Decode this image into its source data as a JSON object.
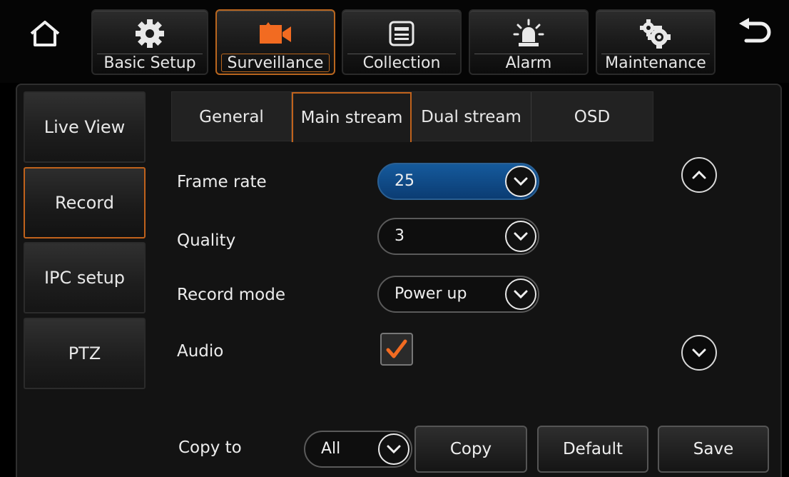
{
  "topnav": {
    "tabs": [
      {
        "label": "Basic Setup",
        "icon": "gear-icon"
      },
      {
        "label": "Surveillance",
        "icon": "camera-icon",
        "active": true
      },
      {
        "label": "Collection",
        "icon": "list-window-icon"
      },
      {
        "label": "Alarm",
        "icon": "alarm-light-icon"
      },
      {
        "label": "Maintenance",
        "icon": "maintenance-gear-icon"
      }
    ]
  },
  "sidebar": {
    "items": [
      {
        "label": "Live View"
      },
      {
        "label": "Record",
        "active": true
      },
      {
        "label": "IPC setup"
      },
      {
        "label": "PTZ"
      }
    ]
  },
  "subtabs": {
    "items": [
      {
        "label": "General"
      },
      {
        "label": "Main stream",
        "active": true
      },
      {
        "label": "Dual stream"
      },
      {
        "label": "OSD"
      }
    ]
  },
  "form": {
    "frame_rate": {
      "label": "Frame rate",
      "value": "25"
    },
    "quality": {
      "label": "Quality",
      "value": "3"
    },
    "record_mode": {
      "label": "Record mode",
      "value": "Power up"
    },
    "audio": {
      "label": "Audio",
      "checked": true
    }
  },
  "footer": {
    "copy_to_label": "Copy to",
    "copy_to_value": "All",
    "copy_button": "Copy",
    "default_button": "Default",
    "save_button": "Save"
  },
  "colors": {
    "accent_orange": "#c0621c",
    "selected_blue": "#0b3c73",
    "check_orange": "#f26b21"
  }
}
